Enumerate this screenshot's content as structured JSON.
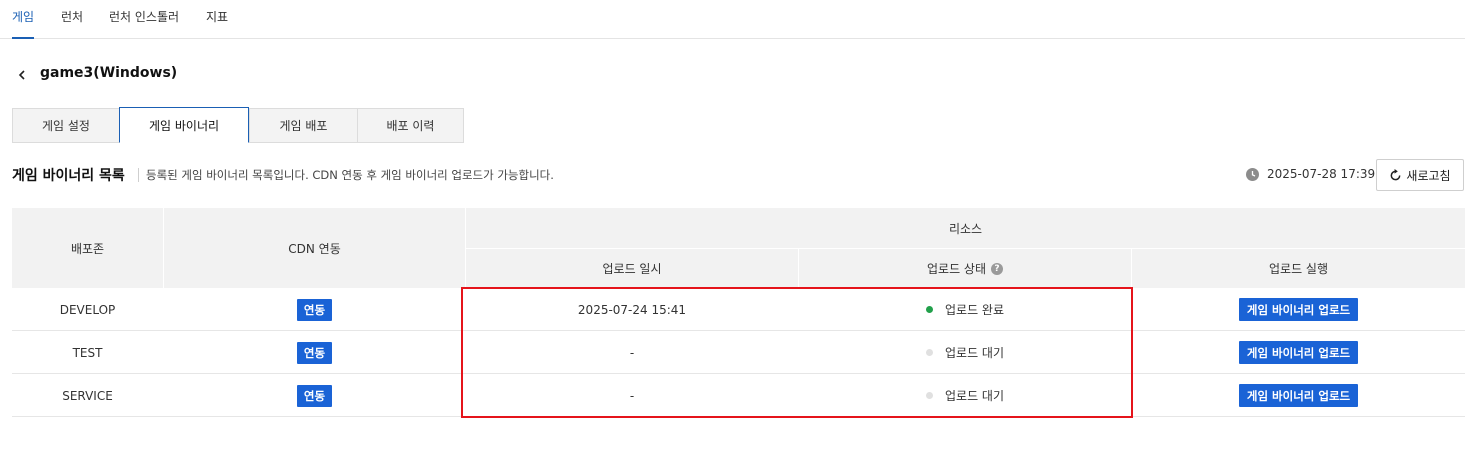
{
  "topnav": {
    "items": [
      {
        "label": "게임",
        "active": true
      },
      {
        "label": "런처",
        "active": false
      },
      {
        "label": "런처 인스톨러",
        "active": false
      },
      {
        "label": "지표",
        "active": false
      }
    ]
  },
  "page": {
    "title": "game3(Windows)"
  },
  "tabs": [
    {
      "label": "게임 설정"
    },
    {
      "label": "게임 바이너리"
    },
    {
      "label": "게임 배포"
    },
    {
      "label": "배포 이력"
    }
  ],
  "section": {
    "title": "게임 바이너리 목록",
    "description": "등록된 게임 바이너리 목록입니다. CDN 연동 후 게임 바이너리 업로드가 가능합니다.",
    "timestamp": "2025-07-28 17:39",
    "refresh_label": "새로고침"
  },
  "table": {
    "headers": {
      "zone": "배포존",
      "cdn": "CDN 연동",
      "resource": "리소스",
      "upload_time": "업로드 일시",
      "upload_status": "업로드 상태",
      "upload_action": "업로드 실행"
    },
    "rows": [
      {
        "zone": "DEVELOP",
        "cdn": "연동",
        "upload_time": "2025-07-24 15:41",
        "status": "업로드 완료",
        "status_color": "#22a04b",
        "action": "게임 바이너리 업로드"
      },
      {
        "zone": "TEST",
        "cdn": "연동",
        "upload_time": "-",
        "status": "업로드 대기",
        "status_color": "#e0e0e0",
        "action": "게임 바이너리 업로드"
      },
      {
        "zone": "SERVICE",
        "cdn": "연동",
        "upload_time": "-",
        "status": "업로드 대기",
        "status_color": "#e0e0e0",
        "action": "게임 바이너리 업로드"
      }
    ]
  },
  "colors": {
    "accent": "#1a63d6",
    "highlight": "#e5141b"
  }
}
